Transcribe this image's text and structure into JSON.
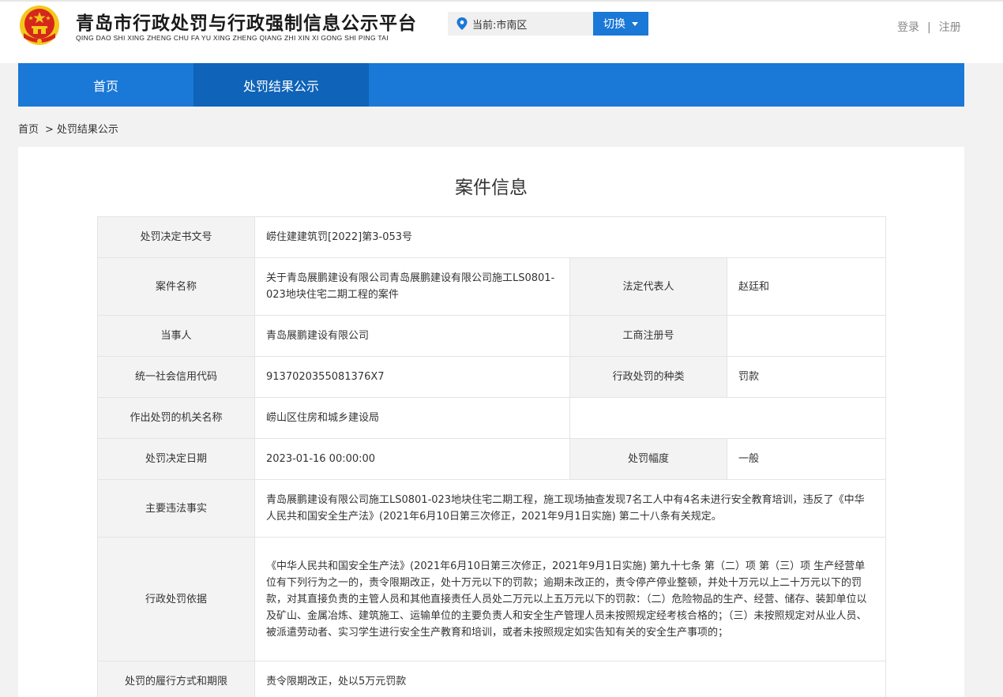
{
  "header": {
    "title": "青岛市行政处罚与行政强制信息公示平台",
    "pinyin": "QING DAO SHI XING ZHENG CHU FA YU XING ZHENG QIANG ZHI XIN XI GONG SHI PING TAI",
    "location_text": "当前:市南区",
    "switch_label": "切换",
    "login": "登录",
    "separator": "|",
    "register": "注册"
  },
  "nav": {
    "items": [
      {
        "label": "首页"
      },
      {
        "label": "处罚结果公示"
      }
    ]
  },
  "breadcrumb": {
    "home": "首页",
    "separator": ">",
    "current": "处罚结果公示"
  },
  "page_title": "案件信息",
  "case": {
    "doc_no_label": "处罚决定书文号",
    "doc_no": "崂住建建筑罚[2022]第3-053号",
    "case_name_label": "案件名称",
    "case_name": "关于青岛展鹏建设有限公司青岛展鹏建设有限公司施工LS0801-023地块住宅二期工程的案件",
    "legal_rep_label": "法定代表人",
    "legal_rep": "赵廷和",
    "party_label": "当事人",
    "party": "青岛展鹏建设有限公司",
    "biz_reg_label": "工商注册号",
    "biz_reg": "",
    "credit_code_label": "统一社会信用代码",
    "credit_code": "9137020355081376X7",
    "penalty_type_label": "行政处罚的种类",
    "penalty_type": "罚款",
    "authority_label": "作出处罚的机关名称",
    "authority": "崂山区住房和城乡建设局",
    "date_label": "处罚决定日期",
    "date": "2023-01-16 00:00:00",
    "degree_label": "处罚幅度",
    "degree": "一般",
    "facts_label": "主要违法事实",
    "facts": "青岛展鹏建设有限公司施工LS0801-023地块住宅二期工程，施工现场抽查发现7名工人中有4名未进行安全教育培训，违反了《中华人民共和国安全生产法》(2021年6月10日第三次修正，2021年9月1日实施) 第二十八条有关规定。",
    "basis_label": "行政处罚依据",
    "basis": "《中华人民共和国安全生产法》(2021年6月10日第三次修正，2021年9月1日实施) 第九十七条 第（二）项 第（三）项 生产经营单位有下列行为之一的，责令限期改正，处十万元以下的罚款；逾期未改正的，责令停产停业整顿，并处十万元以上二十万元以下的罚款，对其直接负责的主管人员和其他直接责任人员处二万元以上五万元以下的罚款：（二）危险物品的生产、经营、储存、装卸单位以及矿山、金属冶炼、建筑施工、运输单位的主要负责人和安全生产管理人员未按照规定经考核合格的；（三）未按照规定对从业人员、被派遣劳动者、实习学生进行安全生产教育和培训，或者未按照规定如实告知有关的安全生产事项的；",
    "execution_label": "处罚的履行方式和期限",
    "execution": "责令限期改正，处以5万元罚款"
  },
  "colors": {
    "brand_blue": "#1a78d6",
    "nav_active": "#0f63b8",
    "emblem_red": "#d7261c",
    "emblem_gold": "#f3c81b"
  }
}
